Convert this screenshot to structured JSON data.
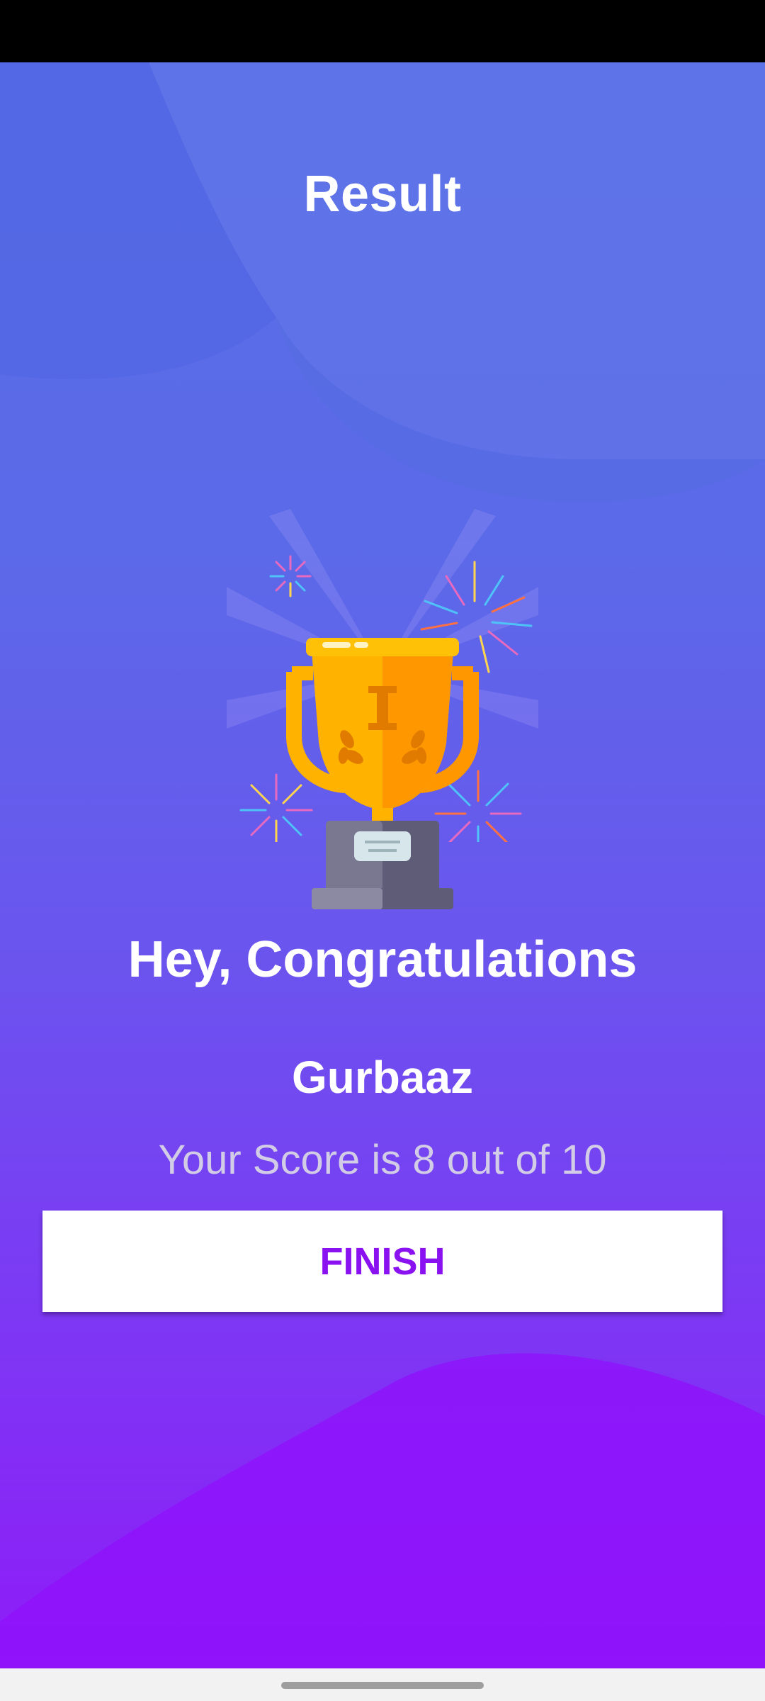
{
  "header": {
    "title": "Result"
  },
  "result": {
    "congrats_text": "Hey, Congratulations",
    "user_name": "Gurbaaz",
    "score_text": "Your Score is 8 out of 10"
  },
  "actions": {
    "finish_label": "FINISH"
  },
  "icons": {
    "trophy": "trophy-icon",
    "fireworks": "fireworks-icon"
  },
  "colors": {
    "gradient_top": "#5a6ee6",
    "gradient_bottom": "#8e1cf8",
    "button_text": "#8a12f0",
    "trophy_gold": "#ffb300"
  }
}
